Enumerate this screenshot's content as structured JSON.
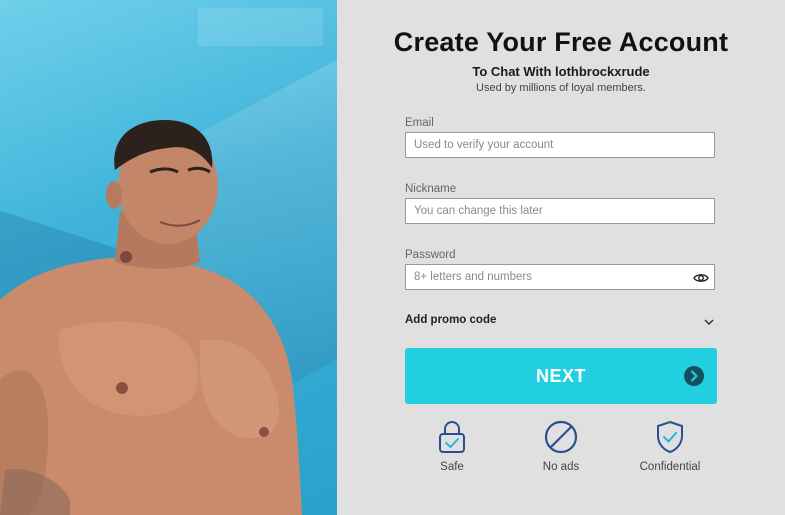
{
  "form": {
    "title": "Create Your Free Account",
    "subtitle": "To Chat With lothbrockxrude",
    "note": "Used by millions of loyal members.",
    "email": {
      "label": "Email",
      "placeholder": "Used to verify your account",
      "value": ""
    },
    "nickname": {
      "label": "Nickname",
      "placeholder": "You can change this later",
      "value": ""
    },
    "password": {
      "label": "Password",
      "placeholder": "8+ letters and numbers",
      "value": ""
    },
    "promo_label": "Add promo code",
    "next_label": "NEXT"
  },
  "badges": [
    {
      "label": "Safe",
      "icon": "lock-icon"
    },
    {
      "label": "No ads",
      "icon": "no-entry-icon"
    },
    {
      "label": "Confidential",
      "icon": "shield-check-icon"
    }
  ],
  "colors": {
    "accent": "#22cfe0",
    "icon": "#2a4f8f",
    "panel_bg": "#e0e0e0"
  }
}
